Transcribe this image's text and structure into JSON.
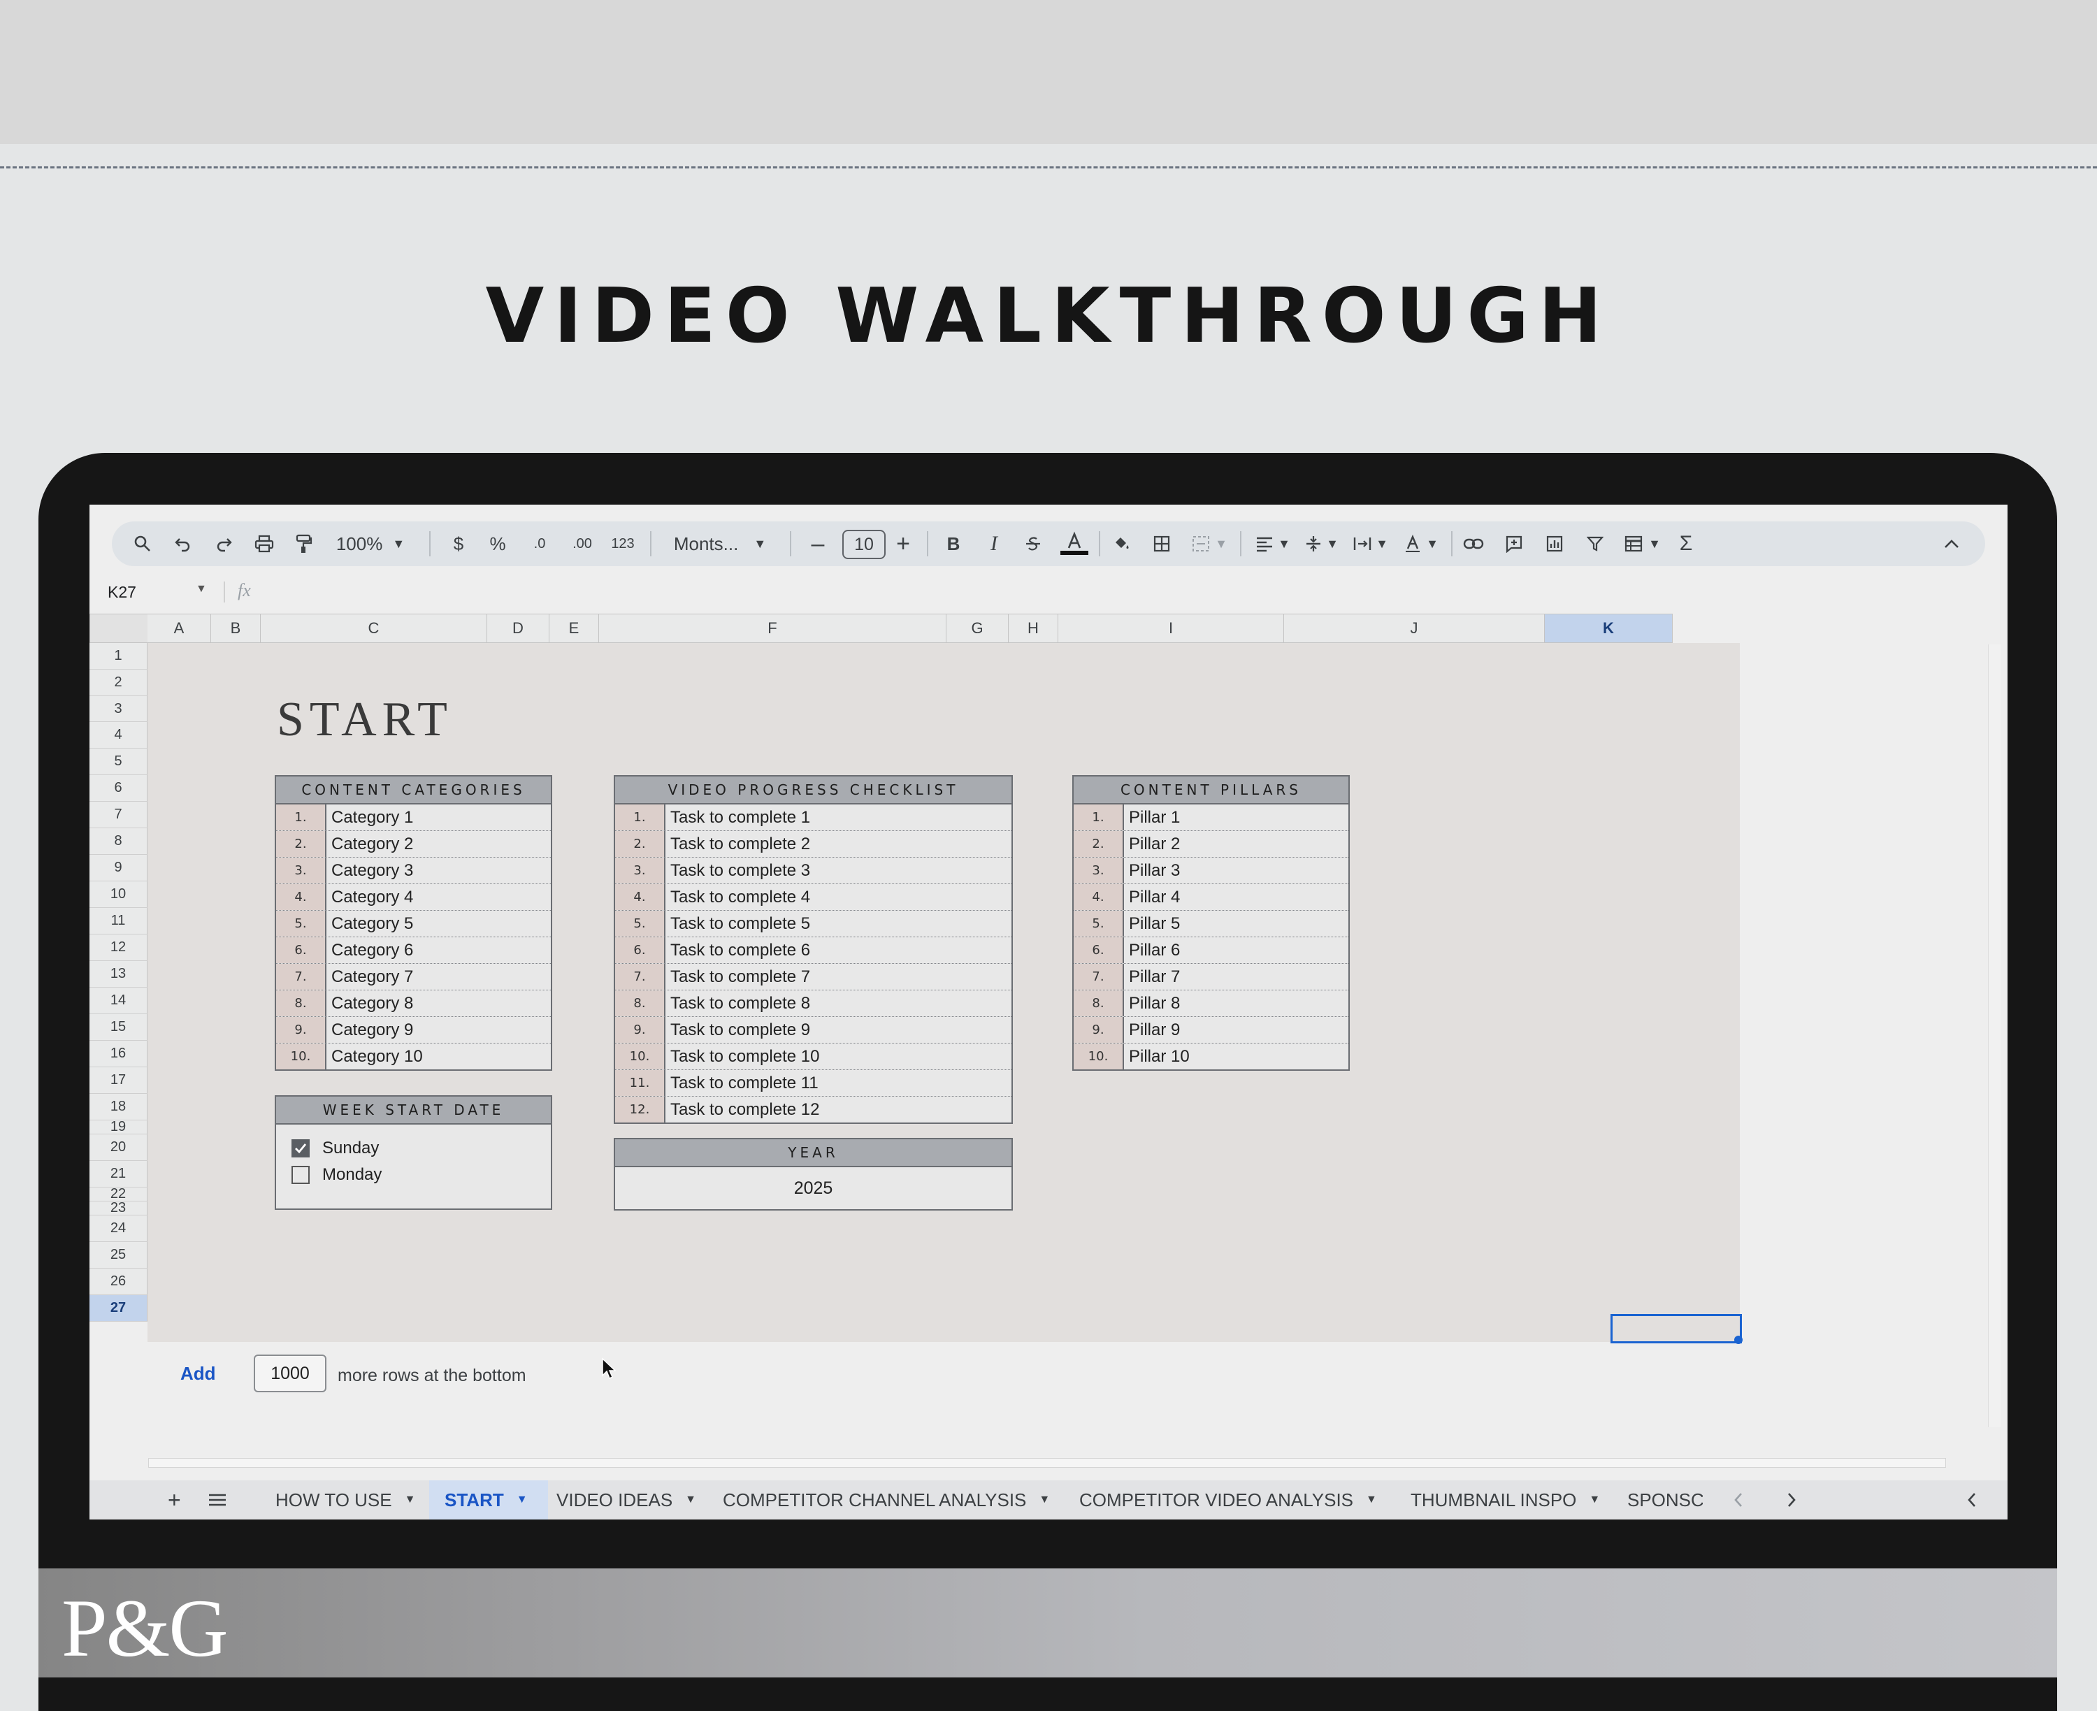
{
  "headline": "VIDEO WALKTHROUGH",
  "brand": "P&G",
  "toolbar": {
    "zoom": "100%",
    "currency": "$",
    "percent": "%",
    "dec_decrease": ".0",
    "dec_increase": ".00",
    "number_format": "123",
    "font": "Monts...",
    "font_size": "10",
    "bold": "B",
    "italic": "I",
    "sum": "Σ"
  },
  "formula_bar": {
    "cell_ref": "K27",
    "fx": "fx"
  },
  "columns": [
    "A",
    "B",
    "C",
    "D",
    "E",
    "F",
    "G",
    "H",
    "I",
    "J",
    "K"
  ],
  "selected_column": "K",
  "rows": [
    "1",
    "2",
    "3",
    "4",
    "5",
    "6",
    "7",
    "8",
    "9",
    "10",
    "11",
    "12",
    "13",
    "14",
    "15",
    "16",
    "17",
    "18",
    "19",
    "20",
    "21",
    "22",
    "23",
    "24",
    "25",
    "26",
    "27"
  ],
  "selected_row": "27",
  "sheet_title": "START",
  "content_categories": {
    "title": "CONTENT CATEGORIES",
    "items": [
      {
        "num": "1.",
        "label": "Category 1"
      },
      {
        "num": "2.",
        "label": "Category 2"
      },
      {
        "num": "3.",
        "label": "Category 3"
      },
      {
        "num": "4.",
        "label": "Category 4"
      },
      {
        "num": "5.",
        "label": "Category 5"
      },
      {
        "num": "6.",
        "label": "Category 6"
      },
      {
        "num": "7.",
        "label": "Category 7"
      },
      {
        "num": "8.",
        "label": "Category 8"
      },
      {
        "num": "9.",
        "label": "Category 9"
      },
      {
        "num": "10.",
        "label": "Category 10"
      }
    ]
  },
  "video_checklist": {
    "title": "VIDEO PROGRESS CHECKLIST",
    "items": [
      {
        "num": "1.",
        "label": "Task to complete 1"
      },
      {
        "num": "2.",
        "label": "Task to complete 2"
      },
      {
        "num": "3.",
        "label": "Task to complete 3"
      },
      {
        "num": "4.",
        "label": "Task to complete 4"
      },
      {
        "num": "5.",
        "label": "Task to complete 5"
      },
      {
        "num": "6.",
        "label": "Task to complete 6"
      },
      {
        "num": "7.",
        "label": "Task to complete 7"
      },
      {
        "num": "8.",
        "label": "Task to complete 8"
      },
      {
        "num": "9.",
        "label": "Task to complete 9"
      },
      {
        "num": "10.",
        "label": "Task to complete 10"
      },
      {
        "num": "11.",
        "label": "Task to complete 11"
      },
      {
        "num": "12.",
        "label": "Task to complete 12"
      }
    ]
  },
  "content_pillars": {
    "title": "CONTENT PILLARS",
    "items": [
      {
        "num": "1.",
        "label": "Pillar 1"
      },
      {
        "num": "2.",
        "label": "Pillar 2"
      },
      {
        "num": "3.",
        "label": "Pillar 3"
      },
      {
        "num": "4.",
        "label": "Pillar 4"
      },
      {
        "num": "5.",
        "label": "Pillar 5"
      },
      {
        "num": "6.",
        "label": "Pillar 6"
      },
      {
        "num": "7.",
        "label": "Pillar 7"
      },
      {
        "num": "8.",
        "label": "Pillar 8"
      },
      {
        "num": "9.",
        "label": "Pillar 9"
      },
      {
        "num": "10.",
        "label": "Pillar 10"
      }
    ]
  },
  "week_start": {
    "title": "WEEK START DATE",
    "options": [
      {
        "label": "Sunday",
        "checked": true
      },
      {
        "label": "Monday",
        "checked": false
      }
    ]
  },
  "year": {
    "title": "YEAR",
    "value": "2025"
  },
  "add_rows": {
    "button": "Add",
    "count": "1000",
    "suffix": "more rows at the bottom"
  },
  "sheet_tabs": [
    {
      "label": "HOW TO USE",
      "active": false
    },
    {
      "label": "START",
      "active": true
    },
    {
      "label": "VIDEO IDEAS",
      "active": false
    },
    {
      "label": "COMPETITOR CHANNEL ANALYSIS",
      "active": false
    },
    {
      "label": "COMPETITOR VIDEO ANALYSIS",
      "active": false
    },
    {
      "label": "THUMBNAIL INSPO",
      "active": false
    },
    {
      "label": "SPONSC",
      "active": false
    }
  ],
  "colors": {
    "accent": "#1a63d1",
    "header_gray": "#a8abb0",
    "number_pink": "#dccfcb",
    "sheet_bg": "#e2dfdd"
  }
}
